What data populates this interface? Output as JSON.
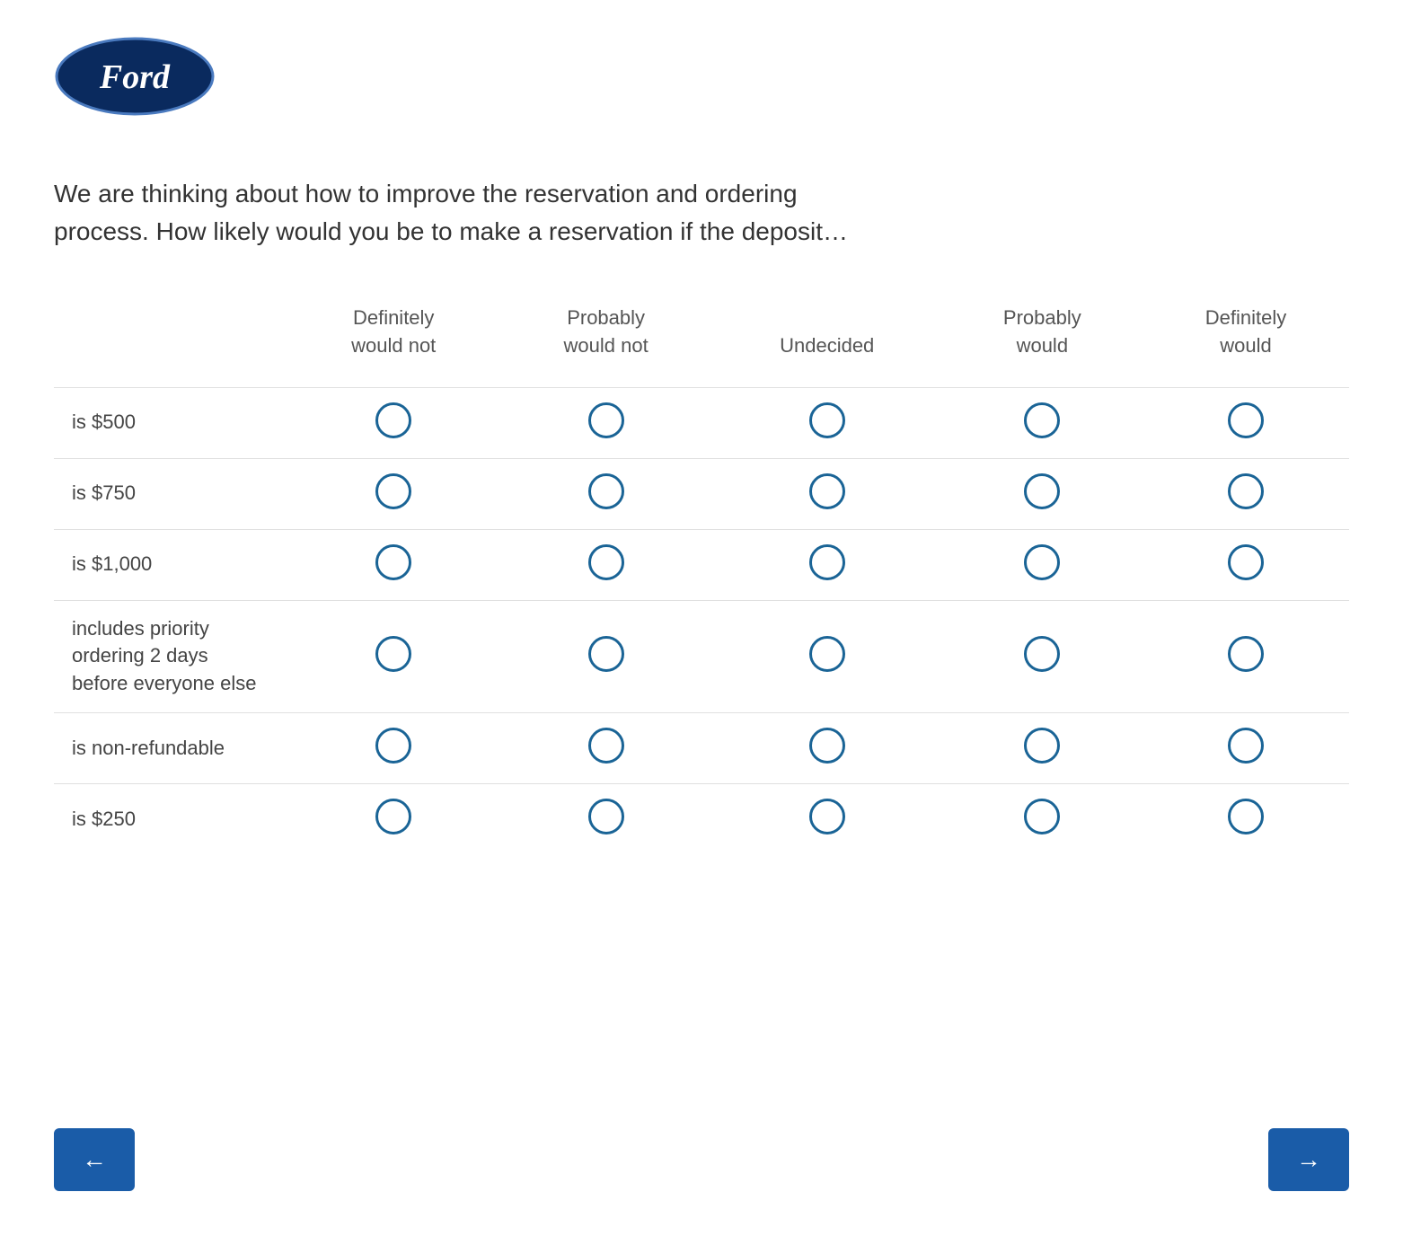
{
  "header": {
    "logo_alt": "Ford"
  },
  "question": {
    "text": "We are thinking about how to improve the reservation and ordering process. How likely would you be to make a reservation if the deposit…"
  },
  "table": {
    "columns": [
      {
        "id": "row-label",
        "label": ""
      },
      {
        "id": "definitely-not",
        "label": "Definitely\nwould not"
      },
      {
        "id": "probably-not",
        "label": "Probably\nwould not"
      },
      {
        "id": "undecided",
        "label": "Undecided"
      },
      {
        "id": "probably-would",
        "label": "Probably\nwould"
      },
      {
        "id": "definitely-would",
        "label": "Definitely\nwould"
      }
    ],
    "rows": [
      {
        "label": "is $500"
      },
      {
        "label": "is $750"
      },
      {
        "label": "is $1,000"
      },
      {
        "label": "includes priority ordering 2 days before everyone else"
      },
      {
        "label": "is non-refundable"
      },
      {
        "label": "is $250"
      }
    ]
  },
  "navigation": {
    "back_label": "←",
    "next_label": "→"
  }
}
